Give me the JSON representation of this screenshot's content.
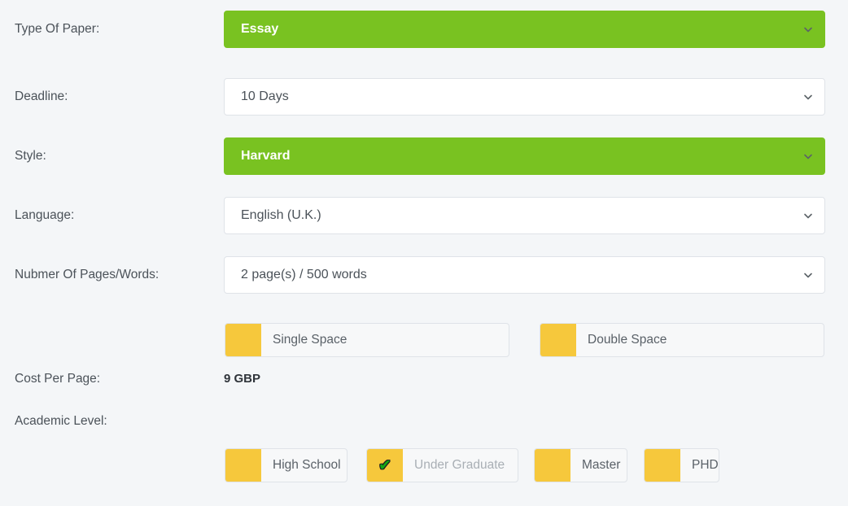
{
  "form": {
    "fields": [
      {
        "label": "Type Of Paper:",
        "value": "Essay",
        "style": "accent"
      },
      {
        "label": "Deadline:",
        "value": "10 Days",
        "style": "plain"
      },
      {
        "label": "Style:",
        "value": "Harvard",
        "style": "accent"
      },
      {
        "label": "Language:",
        "value": "English (U.K.)",
        "style": "plain"
      },
      {
        "label": "Nubmer Of Pages/Words:",
        "value": "2 page(s) / 500 words",
        "style": "plain"
      }
    ],
    "spacing_options": [
      {
        "label": "Single Space",
        "selected": false
      },
      {
        "label": "Double Space",
        "selected": false
      }
    ],
    "cost": {
      "label": "Cost Per Page:",
      "value": "9 GBP"
    },
    "academic_level": {
      "label": "Academic Level:",
      "options": [
        {
          "label": "High School",
          "selected": false
        },
        {
          "label": "Under Graduate",
          "selected": true
        },
        {
          "label": "Master",
          "selected": false
        },
        {
          "label": "PHD",
          "selected": false
        }
      ]
    },
    "icons": {
      "dropdown": "chevron-down-icon",
      "check": "check-icon",
      "check_glyph": "✔"
    },
    "colors": {
      "accent_green": "#79c221",
      "swatch_yellow": "#f6c83c",
      "check_green": "#15a814",
      "page_background": "#f4f6f8"
    }
  }
}
